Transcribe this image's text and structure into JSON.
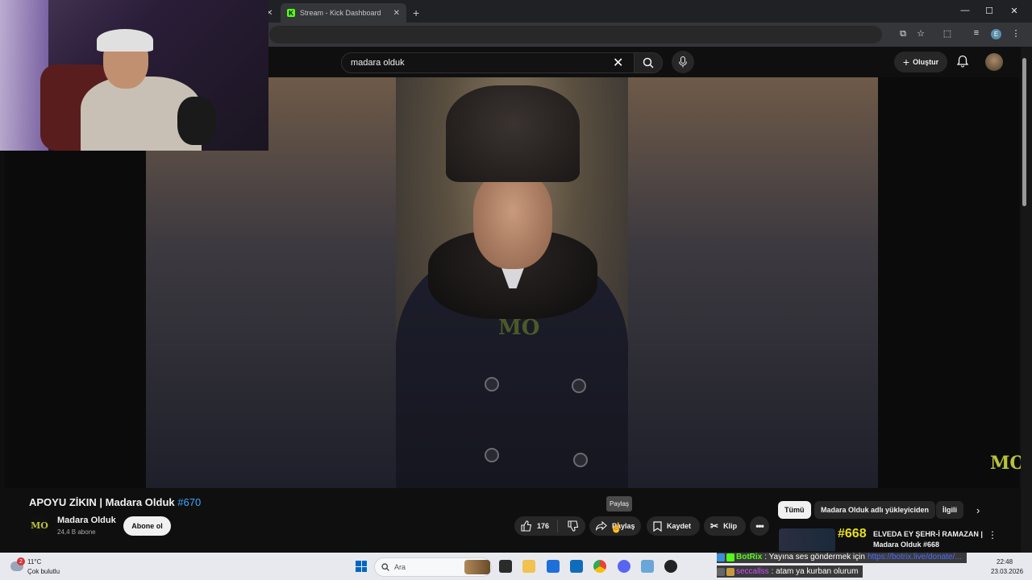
{
  "browser": {
    "tabs": [
      {
        "title": "Stream - Kick Dashboard"
      }
    ],
    "window_controls": {
      "minimize": "—",
      "maximize": "☐",
      "close": "✕"
    },
    "profile_initial": "E"
  },
  "youtube": {
    "search": {
      "value": "madara olduk"
    },
    "create_label": "Oluştur",
    "video": {
      "title": "APOYU ZİKIN | Madara Olduk",
      "hashtag": "#670",
      "watermark": "MO"
    },
    "channel": {
      "name": "Madara Olduk",
      "subscribers": "24,4 B abone",
      "subscribe_label": "Abone ol",
      "avatar_text": "MO"
    },
    "actions": {
      "like_count": "176",
      "share_label": "Paylaş",
      "save_label": "Kaydet",
      "clip_label": "Klip",
      "tooltip": "Paylaş"
    },
    "chips": [
      "Tümü",
      "Madara Olduk adlı yükleyiciden",
      "İlgili"
    ],
    "recommendation": {
      "number": "#668",
      "title": "ELVEDA EY ŞEHR-İ RAMAZAN | Madara Olduk #668"
    }
  },
  "taskbar": {
    "weather_temp": "11°C",
    "weather_desc": "Çok bulutlu",
    "weather_badge": "2",
    "search_placeholder": "Ara",
    "time": "22:48",
    "date": "23.03.2026"
  },
  "chat": [
    {
      "user": "BotRix",
      "message": ": Yayına ses göndermek için",
      "link": "https://botrix.live/donate/..."
    },
    {
      "user": "seccallss",
      "message": ": atam ya kurban olurum"
    }
  ],
  "colors": {
    "youtube_bg": "#0f0f0f",
    "hashtag": "#3ea6ff",
    "kick_green": "#53fc18",
    "recommendation_number": "#e8e020"
  }
}
